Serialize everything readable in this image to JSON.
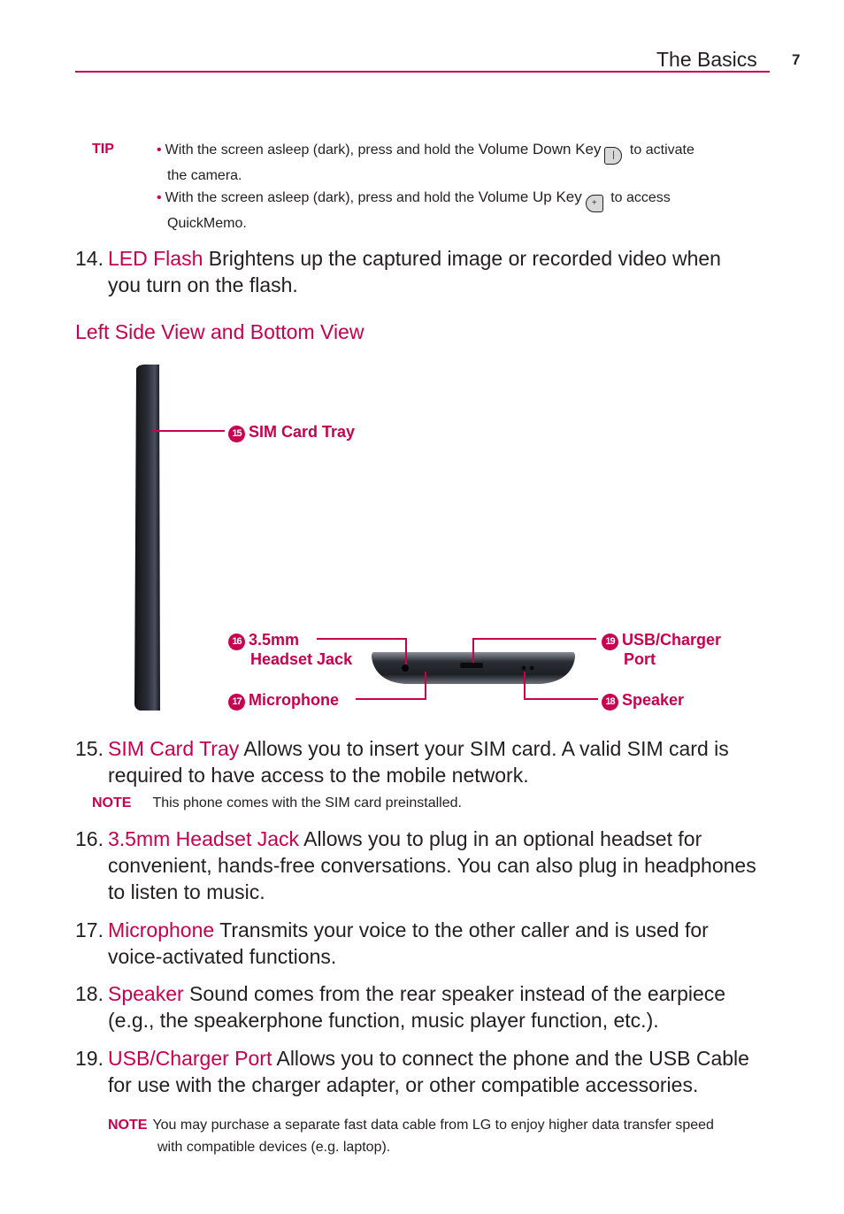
{
  "header": {
    "section_title": "The Basics",
    "page_number": "7"
  },
  "tip": {
    "label": "TIP",
    "items": [
      {
        "before": "With the screen asleep (dark), press and hold the ",
        "key_name": "Volume Down Key",
        "key_icon": "volume-down-key-icon",
        "key_glyph": "|",
        "after_line1": " to activate",
        "line2": "the camera."
      },
      {
        "before": "With the screen asleep (dark), press and hold the ",
        "key_name": "Volume Up Key",
        "key_icon": "volume-up-key-icon",
        "key_glyph": "+",
        "after_line1": " to access",
        "line2": "QuickMemo."
      }
    ]
  },
  "item14": {
    "number": "14.",
    "term": "LED Flash",
    "line1": " Brightens up the captured image or recorded video when",
    "line2": "you turn on the flash."
  },
  "section": {
    "title": "Left Side View and Bottom View"
  },
  "diagram": {
    "callouts": [
      {
        "badge": "15",
        "line1": "SIM Card Tray"
      },
      {
        "badge": "16",
        "line1": "3.5mm",
        "line2": "Headset Jack"
      },
      {
        "badge": "17",
        "line1": "Microphone"
      },
      {
        "badge": "19",
        "line1": "USB/Charger",
        "line2": "Port"
      },
      {
        "badge": "18",
        "line1": "Speaker"
      }
    ]
  },
  "items": [
    {
      "number": "15.",
      "term": "SIM Card Tray",
      "lines": [
        " Allows you to insert your SIM card. A valid SIM card is",
        "required to have access to the mobile network."
      ],
      "note": {
        "label": "NOTE",
        "text": "This phone comes with the SIM card preinstalled."
      }
    },
    {
      "number": "16.",
      "term": "3.5mm Headset Jack",
      "lines": [
        " Allows you to plug in an optional headset for",
        "convenient, hands-free conversations. You can also plug in headphones",
        "to listen to music."
      ]
    },
    {
      "number": "17.",
      "term": "Microphone",
      "lines": [
        " Transmits your voice to the other caller and is used for",
        "voice-activated functions."
      ]
    },
    {
      "number": "18.",
      "term": "Speaker",
      "lines": [
        " Sound comes from the rear speaker instead of the earpiece",
        "(e.g., the speakerphone function, music player function, etc.)."
      ]
    },
    {
      "number": "19.",
      "term": "USB/Charger Port",
      "lines": [
        " Allows you to connect the phone and the USB Cable",
        "for use with the charger adapter, or other compatible accessories."
      ],
      "note": {
        "label": "NOTE",
        "line1": "You may purchase a separate fast data cable from LG to enjoy higher data transfer speed",
        "line2": "with compatible devices (e.g. laptop)."
      }
    }
  ],
  "colors": {
    "accent": "#c8004f",
    "text": "#231f20"
  }
}
